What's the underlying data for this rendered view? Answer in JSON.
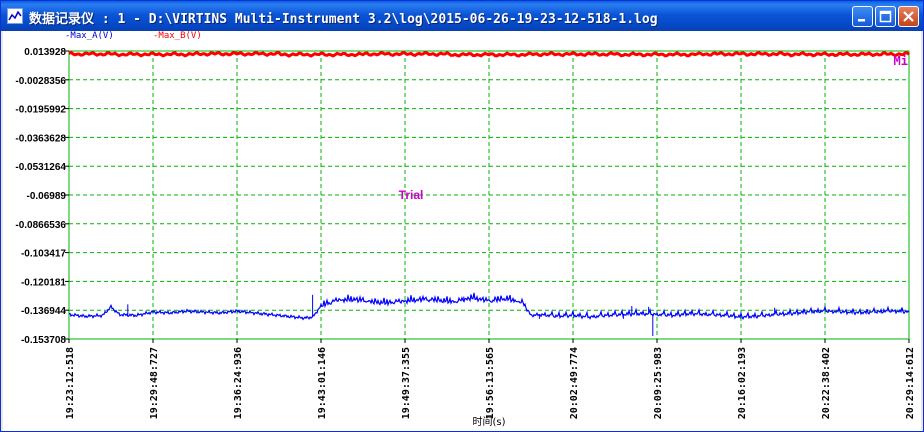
{
  "window": {
    "title": "数据记录仪 : 1 - D:\\VIRTINS Multi-Instrument 3.2\\log\\2015-06-26-19-23-12-518-1.log",
    "buttons": [
      "minimize",
      "maximize",
      "close"
    ]
  },
  "legend": {
    "series_a": "-Max_A(V)",
    "series_b": "-Max_B(V)"
  },
  "watermark": "Trial",
  "corner_label": "Mi",
  "colors": {
    "series_a": "#0000ff",
    "series_b": "#ff0000",
    "grid": "#00b400",
    "watermark": "#cc00cc"
  },
  "chart_data": {
    "type": "line",
    "xlabel": "时间(s)",
    "ylabel": "",
    "yticks": [
      "0.013928",
      "-0.0028356",
      "-0.0195992",
      "-0.0363628",
      "-0.0531264",
      "-0.06989",
      "-0.0866536",
      "-0.103417",
      "-0.120181",
      "-0.136944",
      "-0.153708"
    ],
    "ylim": [
      -0.153708,
      0.013928
    ],
    "xticks": [
      "19:23:12:518",
      "19:29:48:727",
      "19:36:24:936",
      "19:43:01:146",
      "19:49:37:355",
      "19:56:13:565",
      "20:02:49:774",
      "20:09:25:983",
      "20:16:02:193",
      "20:22:38:402",
      "20:29:14:612"
    ],
    "grid": true,
    "series": [
      {
        "name": "Max_A(V)",
        "color": "#0000ff",
        "points": [
          [
            0,
            -0.1395
          ],
          [
            2,
            -0.1405
          ],
          [
            4,
            -0.14
          ],
          [
            5,
            -0.135
          ],
          [
            6,
            -0.1395
          ],
          [
            8,
            -0.14
          ],
          [
            10,
            -0.138
          ],
          [
            12,
            -0.1385
          ],
          [
            14,
            -0.1375
          ],
          [
            16,
            -0.138
          ],
          [
            18,
            -0.1385
          ],
          [
            20,
            -0.1375
          ],
          [
            22,
            -0.1385
          ],
          [
            24,
            -0.1395
          ],
          [
            26,
            -0.1405
          ],
          [
            28,
            -0.1415
          ],
          [
            29,
            -0.141
          ],
          [
            30,
            -0.1345
          ],
          [
            32,
            -0.1315
          ],
          [
            34,
            -0.131
          ],
          [
            36,
            -0.1325
          ],
          [
            38,
            -0.133
          ],
          [
            40,
            -0.132
          ],
          [
            42,
            -0.131
          ],
          [
            44,
            -0.1315
          ],
          [
            46,
            -0.1325
          ],
          [
            48,
            -0.13
          ],
          [
            50,
            -0.132
          ],
          [
            52,
            -0.1305
          ],
          [
            54,
            -0.133
          ],
          [
            55,
            -0.14
          ],
          [
            56,
            -0.1395
          ],
          [
            58,
            -0.1405
          ],
          [
            60,
            -0.14
          ],
          [
            62,
            -0.141
          ],
          [
            64,
            -0.14
          ],
          [
            66,
            -0.1395
          ],
          [
            68,
            -0.139
          ],
          [
            70,
            -0.1395
          ],
          [
            72,
            -0.14
          ],
          [
            74,
            -0.139
          ],
          [
            76,
            -0.1395
          ],
          [
            78,
            -0.14
          ],
          [
            80,
            -0.141
          ],
          [
            82,
            -0.1405
          ],
          [
            84,
            -0.1395
          ],
          [
            86,
            -0.139
          ],
          [
            88,
            -0.138
          ],
          [
            90,
            -0.1375
          ],
          [
            92,
            -0.138
          ],
          [
            94,
            -0.1385
          ],
          [
            96,
            -0.138
          ],
          [
            98,
            -0.1375
          ],
          [
            100,
            -0.138
          ]
        ],
        "spikes": [
          [
            7,
            -0.1335
          ],
          [
            29,
            -0.128
          ],
          [
            34,
            -0.13
          ],
          [
            42,
            -0.13
          ],
          [
            47,
            -0.129
          ],
          [
            51,
            -0.129
          ],
          [
            67,
            -0.1345
          ],
          [
            69,
            -0.135
          ],
          [
            84,
            -0.1355
          ],
          [
            97,
            -0.136
          ]
        ],
        "dips": [
          [
            56,
            -0.142
          ],
          [
            69.5,
            -0.152
          ],
          [
            66,
            -0.142
          ]
        ]
      },
      {
        "name": "Max_B(V)",
        "color": "#ff0000",
        "points": [
          [
            0,
            0.0122
          ],
          [
            10,
            0.012
          ],
          [
            20,
            0.0123
          ],
          [
            30,
            0.0119
          ],
          [
            40,
            0.0122
          ],
          [
            50,
            0.0118
          ],
          [
            60,
            0.0121
          ],
          [
            70,
            0.0119
          ],
          [
            80,
            0.0122
          ],
          [
            90,
            0.012
          ],
          [
            100,
            0.0121
          ]
        ]
      }
    ]
  }
}
